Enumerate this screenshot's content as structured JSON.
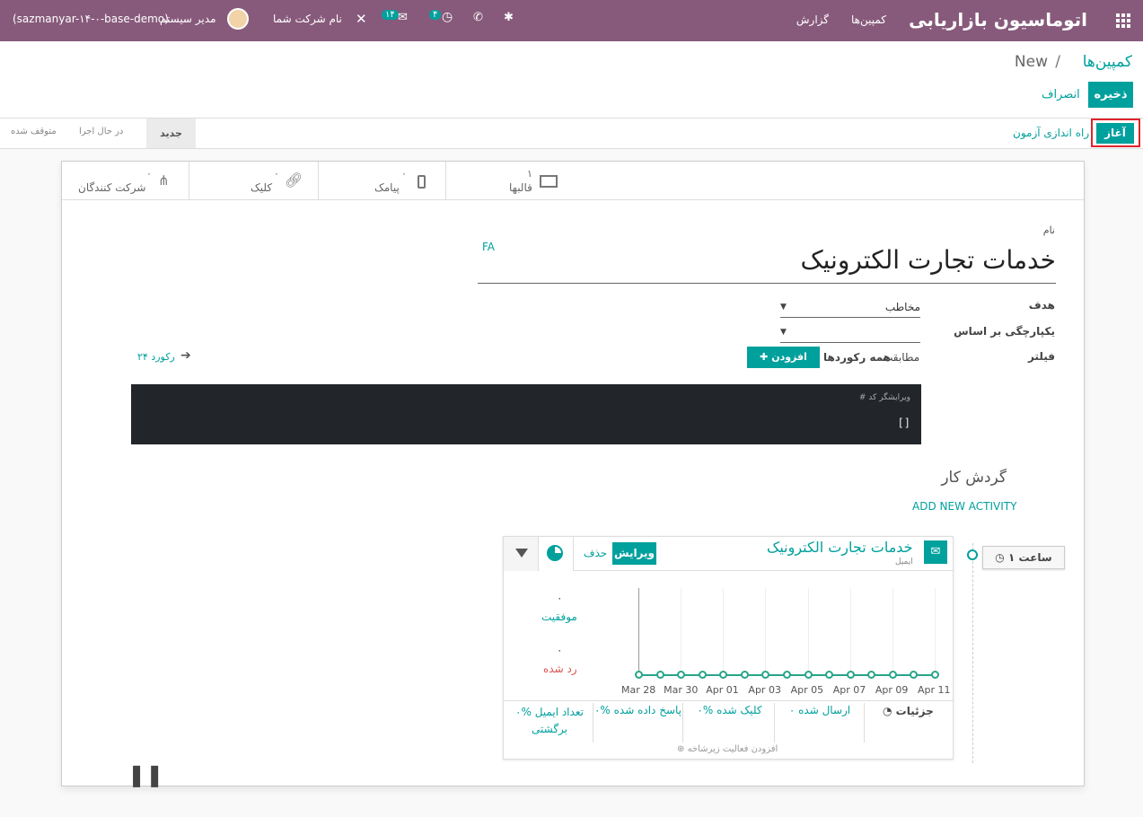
{
  "navbar": {
    "app_title": "اتوماسیون بازاریابی",
    "menu": [
      "کمپین‌ها",
      "گزارش"
    ],
    "db_name": "(sazmanyar-۱۴-۰-base-demo)",
    "user_name": "مدیر سیستم",
    "company": "نام شرکت شما",
    "activity_count": "۴",
    "messages_count": "۱۴"
  },
  "breadcrumb": {
    "parent": "کمپین‌ها",
    "separator": "/",
    "current": "New"
  },
  "actions": {
    "save": "ذخیره",
    "discard": "انصراف"
  },
  "header_buttons": {
    "start": "آغاز",
    "launch_test": "راه اندازی آزمون"
  },
  "statusbar": [
    "جدید",
    "در حال اجرا",
    "متوقف شده"
  ],
  "smart_buttons": [
    {
      "label": "قالبها",
      "count": "۱",
      "icon": "envelope-icon"
    },
    {
      "label": "پیامک",
      "count": "۰",
      "icon": "mobile-icon"
    },
    {
      "label": "کلیک",
      "count": "۰",
      "icon": "link-icon"
    },
    {
      "label": "شرکت کنندگان",
      "count": "۰",
      "icon": "sitemap-icon"
    }
  ],
  "form": {
    "name_label": "نام",
    "name_value": "خدمات تجارت الکترونیک",
    "lang": "FA",
    "target_label": "هدف",
    "target_value": "مخاطب",
    "unicity_label": "یکپارچگی بر اساس",
    "unicity_value": "",
    "filter_label": "فیلتر",
    "filter_match": "مطابقت",
    "filter_all": "همه رکوردها",
    "add_filter": "افزودن فیلتر",
    "records": "۲۴ رکورد",
    "code_comment": "# ویرایشگر کد",
    "code_value": "[]"
  },
  "workflow": {
    "title": "گردش کار",
    "add_activity": "ADD NEW ACTIVITY",
    "trigger": "۱ ساعت"
  },
  "activity": {
    "title": "خدمات تجارت الکترونیک",
    "subtitle": "ایمیل",
    "edit": "ویرایش",
    "delete": "حذف",
    "success_count": "۰",
    "success_label": "موفقیت",
    "rejected_count": "۰",
    "rejected_label": "رد شده",
    "details": "جزئیات",
    "sent": "۰ ارسال شده",
    "clicked": "۰% کلیک شده",
    "replied": "۰% پاسخ داده شده",
    "bounced": "۰% تعداد ایمیل برگشتی",
    "add_child": "افزودن فعالیت زیرشاخه"
  },
  "chart_data": {
    "type": "line",
    "x": [
      "Mar 28",
      "Mar 29",
      "Mar 30",
      "Mar 31",
      "Apr 01",
      "Apr 02",
      "Apr 03",
      "Apr 04",
      "Apr 05",
      "Apr 06",
      "Apr 07",
      "Apr 08",
      "Apr 09",
      "Apr 10",
      "Apr 11"
    ],
    "xticks": [
      "Mar 28",
      "Mar 30",
      "Apr 01",
      "Apr 03",
      "Apr 05",
      "Apr 07",
      "Apr 09",
      "Apr 11"
    ],
    "values": [
      0,
      0,
      0,
      0,
      0,
      0,
      0,
      0,
      0,
      0,
      0,
      0,
      0,
      0,
      0
    ],
    "line_color": "#28a58a"
  },
  "colors": {
    "navbar": "#875a7b",
    "primary": "#00a09d",
    "highlight": "#e0242e"
  }
}
